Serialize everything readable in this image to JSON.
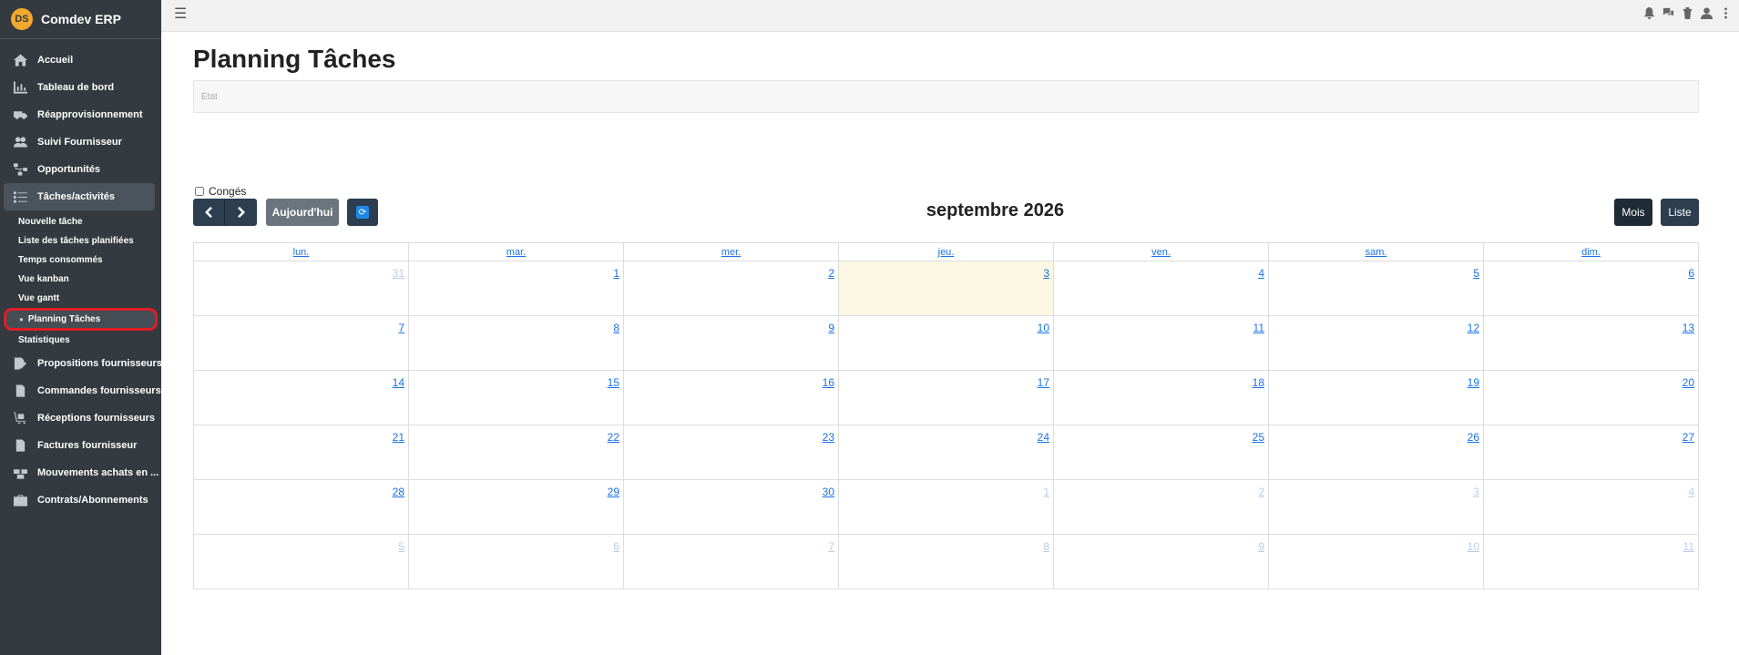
{
  "app": {
    "name": "Comdev ERP",
    "logo_text": "DS"
  },
  "sidebar": {
    "items": [
      {
        "label": "Accueil",
        "icon": "home-icon"
      },
      {
        "label": "Tableau de bord",
        "icon": "chart-icon"
      },
      {
        "label": "Réapprovisionnement",
        "icon": "truck-icon"
      },
      {
        "label": "Suivi Fournisseur",
        "icon": "users-icon"
      },
      {
        "label": "Opportunités",
        "icon": "network-icon"
      },
      {
        "label": "Tâches/activités",
        "icon": "tasks-icon"
      }
    ],
    "sub_items": [
      "Nouvelle tâche",
      "Liste des tâches planifiées",
      "Temps consommés",
      "Vue kanban",
      "Vue gantt",
      "Planning Tâches",
      "Statistiques"
    ],
    "items_after": [
      {
        "label": "Propositions fournisseurs",
        "icon": "file-edit-icon"
      },
      {
        "label": "Commandes fournisseurs",
        "icon": "file-icon"
      },
      {
        "label": "Réceptions fournisseurs",
        "icon": "dolly-icon"
      },
      {
        "label": "Factures fournisseur",
        "icon": "invoice-icon"
      },
      {
        "label": "Mouvements achats en ...",
        "icon": "boxes-icon"
      },
      {
        "label": "Contrats/Abonnements",
        "icon": "briefcase-icon"
      }
    ]
  },
  "topbar": {
    "icons": [
      "bell-icon",
      "chat-icon",
      "trash-icon",
      "user-avatar-icon",
      "more-vertical-icon"
    ]
  },
  "page": {
    "title": "Planning Tâches",
    "filter_placeholder": "État",
    "conges_label": "Congés"
  },
  "toolbar": {
    "today_label": "Aujourd'hui",
    "month_label": "Mois",
    "list_label": "Liste",
    "title": "septembre 2026"
  },
  "calendar": {
    "day_headers": [
      "lun.",
      "mar.",
      "mer.",
      "jeu.",
      "ven.",
      "sam.",
      "dim."
    ],
    "weeks": [
      [
        {
          "d": "31",
          "o": true
        },
        {
          "d": "1"
        },
        {
          "d": "2"
        },
        {
          "d": "3",
          "t": true
        },
        {
          "d": "4"
        },
        {
          "d": "5"
        },
        {
          "d": "6"
        }
      ],
      [
        {
          "d": "7"
        },
        {
          "d": "8"
        },
        {
          "d": "9"
        },
        {
          "d": "10"
        },
        {
          "d": "11"
        },
        {
          "d": "12"
        },
        {
          "d": "13"
        }
      ],
      [
        {
          "d": "14"
        },
        {
          "d": "15"
        },
        {
          "d": "16"
        },
        {
          "d": "17"
        },
        {
          "d": "18"
        },
        {
          "d": "19"
        },
        {
          "d": "20"
        }
      ],
      [
        {
          "d": "21"
        },
        {
          "d": "22"
        },
        {
          "d": "23"
        },
        {
          "d": "24"
        },
        {
          "d": "25"
        },
        {
          "d": "26"
        },
        {
          "d": "27"
        }
      ],
      [
        {
          "d": "28"
        },
        {
          "d": "29"
        },
        {
          "d": "30"
        },
        {
          "d": "1",
          "o": true
        },
        {
          "d": "2",
          "o": true
        },
        {
          "d": "3",
          "o": true
        },
        {
          "d": "4",
          "o": true
        }
      ],
      [
        {
          "d": "5",
          "o": true
        },
        {
          "d": "6",
          "o": true
        },
        {
          "d": "7",
          "o": true
        },
        {
          "d": "8",
          "o": true
        },
        {
          "d": "9",
          "o": true
        },
        {
          "d": "10",
          "o": true
        },
        {
          "d": "11",
          "o": true
        }
      ]
    ]
  }
}
